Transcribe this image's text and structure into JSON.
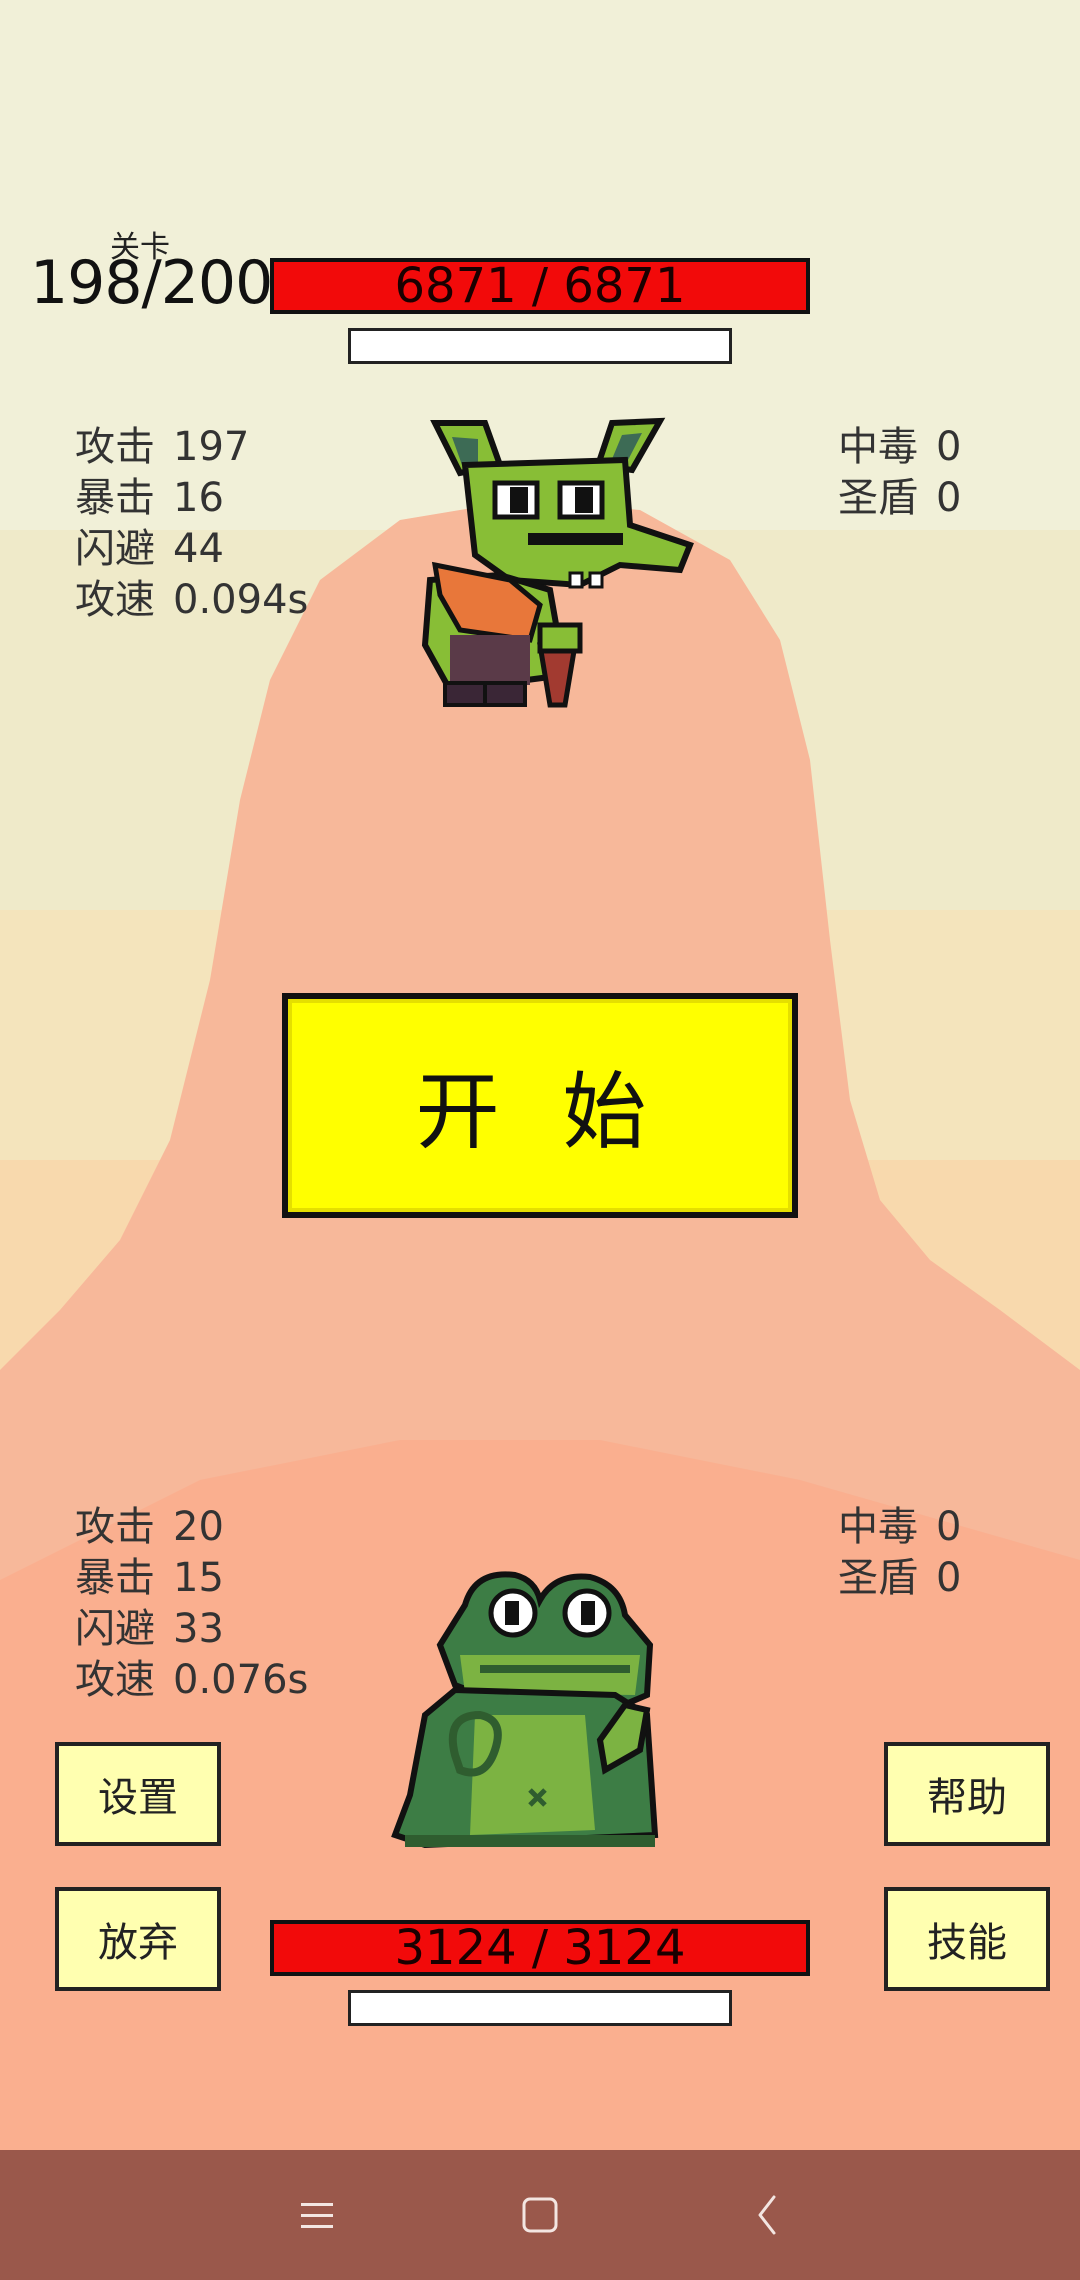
{
  "level": {
    "label": "关卡",
    "value": "198/200"
  },
  "enemy": {
    "hp_text": "6871 / 6871",
    "stats_left": [
      {
        "label": "攻击",
        "value": "197"
      },
      {
        "label": "暴击",
        "value": "16"
      },
      {
        "label": "闪避",
        "value": "44"
      },
      {
        "label": "攻速",
        "value": "0.094s"
      }
    ],
    "stats_right": [
      {
        "label": "中毒",
        "value": "0"
      },
      {
        "label": "圣盾",
        "value": "0"
      }
    ]
  },
  "player": {
    "hp_text": "3124 / 3124",
    "stats_left": [
      {
        "label": "攻击",
        "value": "20"
      },
      {
        "label": "暴击",
        "value": "15"
      },
      {
        "label": "闪避",
        "value": "33"
      },
      {
        "label": "攻速",
        "value": "0.076s"
      }
    ],
    "stats_right": [
      {
        "label": "中毒",
        "value": "0"
      },
      {
        "label": "圣盾",
        "value": "0"
      }
    ]
  },
  "buttons": {
    "start": "开 始",
    "settings": "设置",
    "quit": "放弃",
    "help": "帮助",
    "skills": "技能"
  },
  "nav": {
    "menu_icon": "menu-icon",
    "home_icon": "home-square-icon",
    "back_icon": "back-chevron-icon"
  },
  "colors": {
    "hp_bar": "#f20a0a",
    "start_button": "#ffff00",
    "side_button": "#ffffb0",
    "navbar": "#9a584b",
    "hill": "#f7b89a",
    "ground": "#fb9b7d"
  }
}
